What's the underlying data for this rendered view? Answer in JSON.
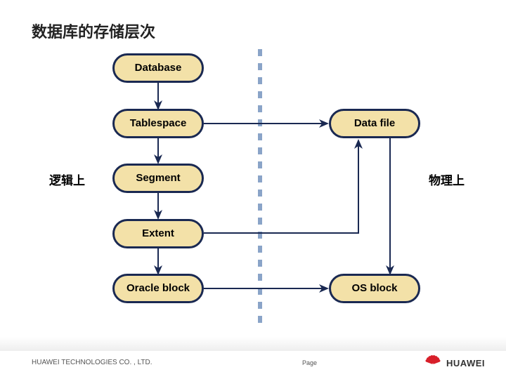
{
  "title": "数据库的存储层次",
  "nodes": {
    "database": "Database",
    "tablespace": "Tablespace",
    "segment": "Segment",
    "extent": "Extent",
    "oracle_block": "Oracle block",
    "data_file": "Data file",
    "os_block": "OS block"
  },
  "labels": {
    "logical": "逻辑上",
    "physical": "物理上"
  },
  "footer": {
    "company": "HUAWEI TECHNOLOGIES CO. , LTD.",
    "page_prefix": "Page",
    "brand": "HUAWEI"
  }
}
